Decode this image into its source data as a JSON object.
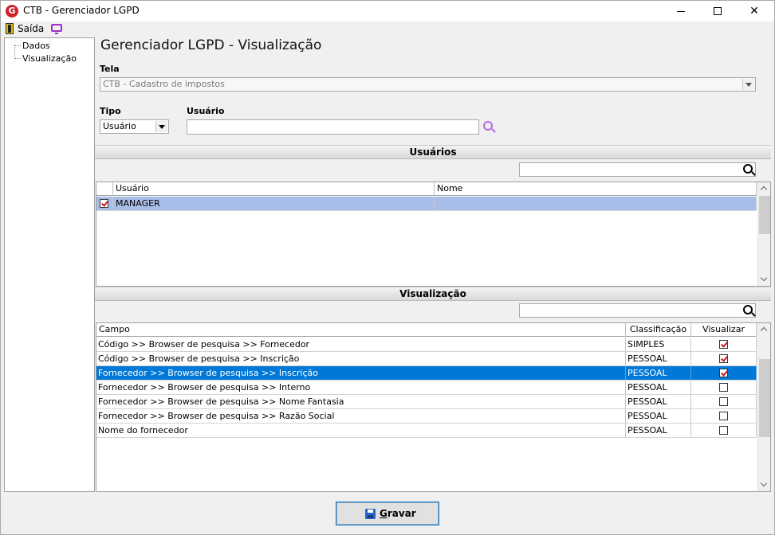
{
  "window": {
    "title": "CTB - Gerenciador LGPD",
    "controls": [
      "minimize",
      "maximize",
      "close"
    ]
  },
  "menu": {
    "exit_label": "Saída"
  },
  "tree": {
    "items": [
      "Dados",
      "Visualização"
    ]
  },
  "main": {
    "title": "Gerenciador LGPD - Visualização",
    "tela_label": "Tela",
    "tela_value": "CTB - Cadastro de impostos",
    "tipo_label": "Tipo",
    "tipo_value": "Usuário",
    "usuario_label": "Usuário",
    "usuario_value": ""
  },
  "usuarios_section": {
    "title": "Usuários",
    "filter_value": "",
    "columns": [
      "Usuário",
      "Nome"
    ],
    "rows": [
      {
        "checked": true,
        "usuario": "MANAGER",
        "nome": ""
      }
    ]
  },
  "visualizacao_section": {
    "title": "Visualização",
    "filter_value": "",
    "columns": [
      "Campo",
      "Classificação",
      "Visualizar"
    ],
    "rows": [
      {
        "campo": "Código >> Browser de pesquisa >> Fornecedor",
        "classificacao": "SIMPLES",
        "visualizar": true
      },
      {
        "campo": "Código >> Browser de pesquisa >> Inscrição",
        "classificacao": "PESSOAL",
        "visualizar": true
      },
      {
        "campo": "Fornecedor >> Browser de pesquisa >> Inscrição",
        "classificacao": "PESSOAL",
        "visualizar": true
      },
      {
        "campo": "Fornecedor >> Browser de pesquisa >> Interno",
        "classificacao": "PESSOAL",
        "visualizar": false
      },
      {
        "campo": "Fornecedor >> Browser de pesquisa >> Nome Fantasia",
        "classificacao": "PESSOAL",
        "visualizar": false
      },
      {
        "campo": "Fornecedor >> Browser de pesquisa >> Razão Social",
        "classificacao": "PESSOAL",
        "visualizar": false
      },
      {
        "campo": "Nome do fornecedor",
        "classificacao": "PESSOAL",
        "visualizar": false
      }
    ],
    "selected_row": 2
  },
  "footer": {
    "save_label": "Gravar"
  },
  "colors": {
    "selection": "#0078d7",
    "row_highlight": "#a8bde8",
    "check_mark": "#d01818",
    "accent_icon": "#b76be0"
  }
}
